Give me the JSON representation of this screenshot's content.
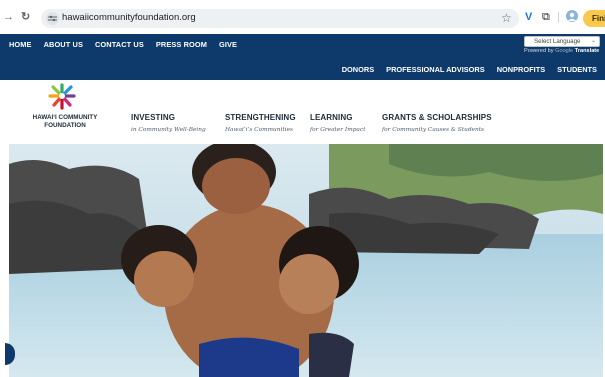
{
  "browser": {
    "back_icon": "arrow-left-icon",
    "reload_icon": "reload-icon",
    "url": "hawaiicommunityfoundation.org",
    "finish_label": "Finis"
  },
  "topnav": {
    "items": [
      "HOME",
      "ABOUT US",
      "CONTACT US",
      "PRESS ROOM",
      "GIVE"
    ]
  },
  "translate": {
    "select_label": "Select Language",
    "powered_by": "Powered by",
    "google": "Google",
    "translate": "Translate"
  },
  "subnav": {
    "items": [
      "DONORS",
      "PROFESSIONAL ADVISORS",
      "NONPROFITS",
      "STUDENTS"
    ]
  },
  "logo": {
    "line1": "HAWAIʻI COMMUNITY",
    "line2": "FOUNDATION"
  },
  "mainnav": {
    "items": [
      {
        "title": "INVESTING",
        "sub": "in Community Well-Being"
      },
      {
        "title": "STRENGTHENING",
        "sub": "Hawaiʻi’s Communities"
      },
      {
        "title": "LEARNING",
        "sub": "for Greater Impact"
      },
      {
        "title": "GRANTS & SCHOLARSHIPS",
        "sub": "for Community Causes & Students"
      }
    ]
  },
  "colors": {
    "header_blue": "#0d3a6a",
    "finish_yellow": "#f8c94c"
  }
}
